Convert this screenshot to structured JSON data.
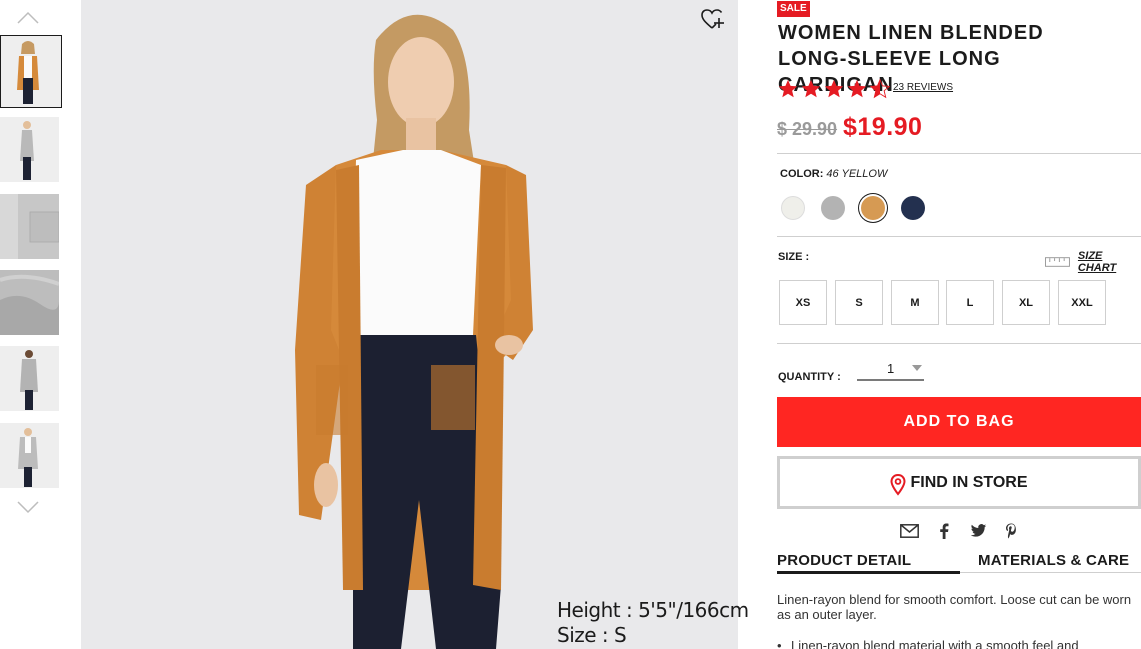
{
  "rail": {
    "up_icon": "chevron-up-icon",
    "down_icon": "chevron-down-icon"
  },
  "main_image": {
    "caption_height": "Height : 5'5\"/166cm",
    "caption_size": "Size : S",
    "wishlist_icon": "heart-plus-icon"
  },
  "product": {
    "sale_badge": "SALE",
    "title": "WOMEN LINEN BLENDED LONG-SLEEVE LONG CARDIGAN",
    "rating": 4.5,
    "rating_max": 5,
    "reviews_label": "23 REVIEWS",
    "old_price": "$ 29.90",
    "new_price": "$19.90",
    "color_label": "COLOR:",
    "color_value": "46 YELLOW",
    "swatches": [
      {
        "name": "off-white",
        "color": "#efefea"
      },
      {
        "name": "gray",
        "color": "#b3b3b3"
      },
      {
        "name": "yellow",
        "color": "#d69a53",
        "selected": true
      },
      {
        "name": "navy",
        "color": "#23304f"
      }
    ],
    "size_label": "SIZE :",
    "size_chart_label": "SIZE CHART",
    "sizes": [
      "XS",
      "S",
      "M",
      "L",
      "XL",
      "XXL"
    ],
    "quantity_label": "QUANTITY :",
    "quantity_value": "1",
    "add_to_bag": "ADD TO BAG",
    "find_in_store": "FIND IN STORE",
    "share_icons": [
      "email-icon",
      "facebook-icon",
      "twitter-icon",
      "pinterest-icon"
    ],
    "tabs": [
      "PRODUCT DETAIL",
      "MATERIALS & CARE"
    ],
    "description": "Linen-rayon blend for smooth comfort. Loose cut can be worn as an outer layer.",
    "bullet": "Linen-rayon blend material with a smooth feel and"
  },
  "colors": {
    "accent_red": "#e51b23",
    "button_red": "#ff2622"
  }
}
